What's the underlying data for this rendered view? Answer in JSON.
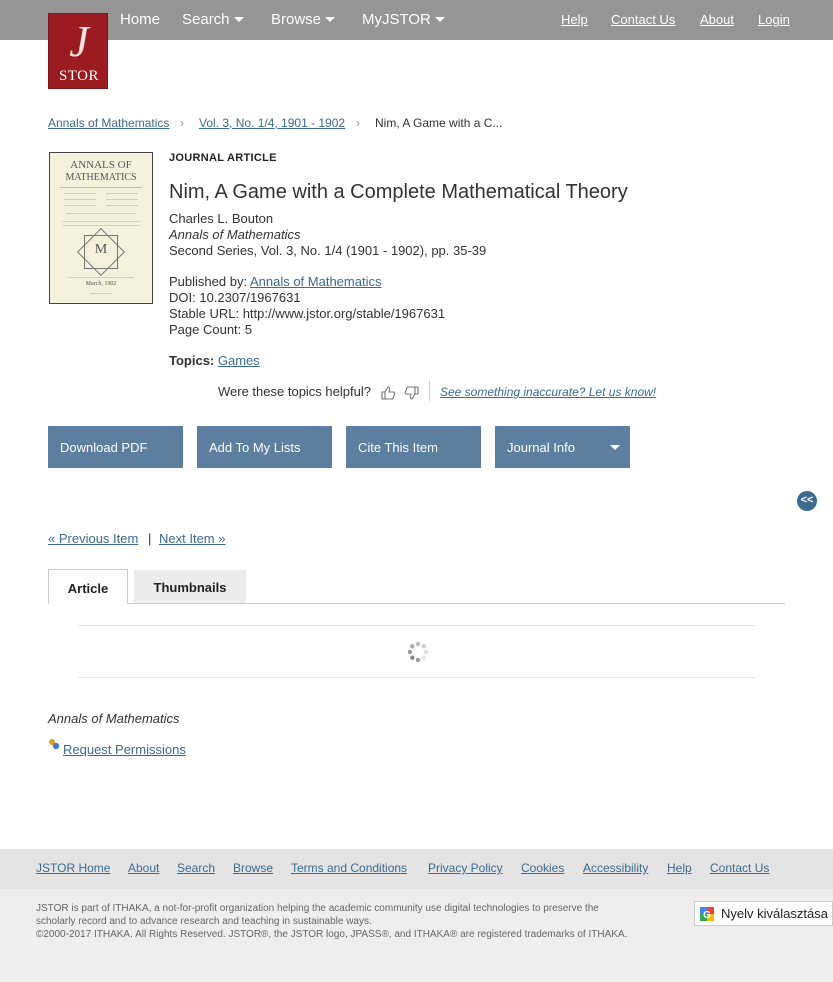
{
  "header": {
    "logo_text": "STOR",
    "nav": [
      {
        "label": "Home",
        "dropdown": false
      },
      {
        "label": "Search",
        "dropdown": true
      },
      {
        "label": "Browse",
        "dropdown": true
      },
      {
        "label": "MyJSTOR",
        "dropdown": true
      }
    ],
    "utility": [
      "Help",
      "Contact Us",
      "About",
      "Login"
    ]
  },
  "breadcrumb": {
    "items": [
      "Annals of Mathematics",
      "Vol. 3, No. 1/4, 1901 - 1902"
    ],
    "current": "Nim, A Game with a C..."
  },
  "cover": {
    "title_line1": "ANNALS OF",
    "title_line2": "MATHEMATICS",
    "date": "March, 1902"
  },
  "article": {
    "type_label": "JOURNAL ARTICLE",
    "title": "Nim, A Game with a Complete Mathematical Theory",
    "author": "Charles L. Bouton",
    "journal": "Annals of Mathematics",
    "series": "Second Series, Vol. 3, No. 1/4 (1901 - 1902), pp. 35-39",
    "published_by_label": "Published by:",
    "publisher": "Annals of Mathematics",
    "doi": "DOI: 10.2307/1967631",
    "stable_url": "Stable URL: http://www.jstor.org/stable/1967631",
    "page_count": "Page Count: 5",
    "topics_label": "Topics:",
    "topic": "Games"
  },
  "feedback": {
    "question": "Were these topics helpful?",
    "inaccurate": "See something inaccurate? Let us know!"
  },
  "actions": {
    "download": "Download PDF",
    "add_to_lists": "Add To My Lists",
    "cite": "Cite This Item",
    "journal_info": "Journal Info"
  },
  "collapse_label": "<<",
  "pager": {
    "previous": "« Previous Item",
    "separator": "|",
    "next": "Next Item »"
  },
  "tabs": {
    "article": "Article",
    "thumbnails": "Thumbnails"
  },
  "below_viewer": {
    "journal": "Annals of Mathematics",
    "permissions": "Request Permissions"
  },
  "footer": {
    "links": [
      "JSTOR Home",
      "About",
      "Search",
      "Browse",
      "Terms and Conditions",
      "Privacy Policy",
      "Cookies",
      "Accessibility",
      "Help",
      "Contact Us"
    ],
    "about_line1": "JSTOR is part of ITHAKA, a not-for-profit organization helping the academic community use digital technologies to preserve the",
    "about_line2": "scholarly record and to advance research and teaching in sustainable ways.",
    "copyright": "©2000-2017 ITHAKA. All Rights Reserved. JSTOR®, the JSTOR logo, JPASS®, and ITHAKA® are registered trademarks of ITHAKA.",
    "translate_label": "Nyelv kiválasztása"
  },
  "colors": {
    "topbar": "#959595",
    "button": "#5c7e9f",
    "link": "#3c6b8e",
    "logo": "#9b1c20"
  }
}
